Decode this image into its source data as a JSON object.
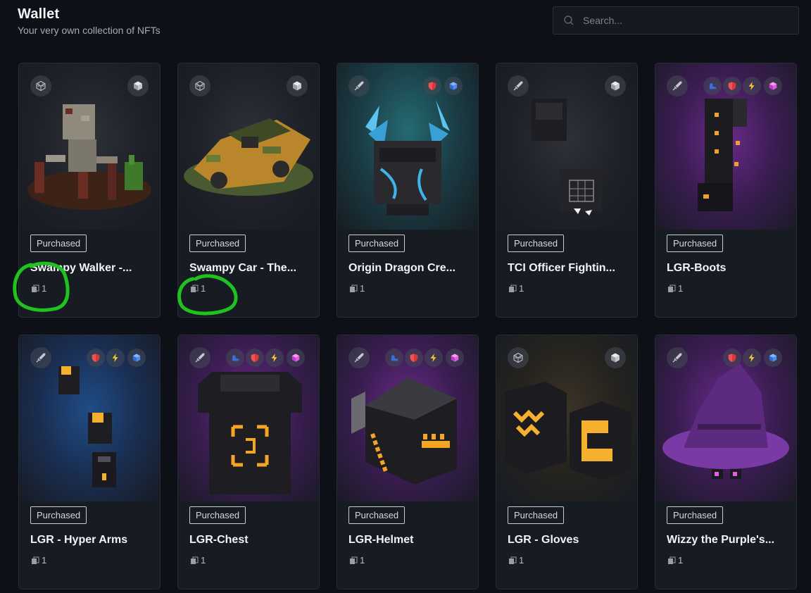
{
  "header": {
    "title": "Wallet",
    "subtitle": "Your very own collection of NFTs"
  },
  "search": {
    "placeholder": "Search...",
    "value": ""
  },
  "cards": [
    {
      "name": "Swampy Walker -...",
      "badge": "Purchased",
      "count": "1",
      "type_icon": "cube-outline-icon",
      "attributes": [
        "grey-cube-icon"
      ]
    },
    {
      "name": "Swampy Car - The...",
      "badge": "Purchased",
      "count": "1",
      "type_icon": "cube-outline-icon",
      "attributes": [
        "grey-cube-icon"
      ]
    },
    {
      "name": "Origin Dragon Cre...",
      "badge": "Purchased",
      "count": "1",
      "type_icon": "sword-icon",
      "attributes": [
        "shield-icon",
        "blue-cube-icon"
      ]
    },
    {
      "name": "TCI Officer Fightin...",
      "badge": "Purchased",
      "count": "1",
      "type_icon": "sword-icon",
      "attributes": [
        "grey-cube-icon"
      ]
    },
    {
      "name": "LGR-Boots",
      "badge": "Purchased",
      "count": "1",
      "type_icon": "sword-icon",
      "attributes": [
        "boot-icon",
        "shield-icon",
        "lightning-icon",
        "pink-cube-icon"
      ]
    },
    {
      "name": "LGR - Hyper Arms",
      "badge": "Purchased",
      "count": "1",
      "type_icon": "sword-icon",
      "attributes": [
        "shield-icon",
        "lightning-icon",
        "blue-cube-icon"
      ]
    },
    {
      "name": "LGR-Chest",
      "badge": "Purchased",
      "count": "1",
      "type_icon": "sword-icon",
      "attributes": [
        "boot-icon",
        "shield-icon",
        "lightning-icon",
        "pink-cube-icon"
      ]
    },
    {
      "name": "LGR-Helmet",
      "badge": "Purchased",
      "count": "1",
      "type_icon": "sword-icon",
      "attributes": [
        "boot-icon",
        "shield-icon",
        "lightning-icon",
        "pink-cube-icon"
      ]
    },
    {
      "name": "LGR - Gloves",
      "badge": "Purchased",
      "count": "1",
      "type_icon": "cube-outline-icon",
      "attributes": [
        "grey-cube-icon"
      ]
    },
    {
      "name": "Wizzy the Purple's...",
      "badge": "Purchased",
      "count": "1",
      "type_icon": "sword-icon",
      "attributes": [
        "shield-icon",
        "lightning-icon",
        "blue-cube-icon"
      ]
    }
  ],
  "colors": {
    "background": "#0d1016",
    "card": "#171b22",
    "annotation": "#1fc21f"
  }
}
